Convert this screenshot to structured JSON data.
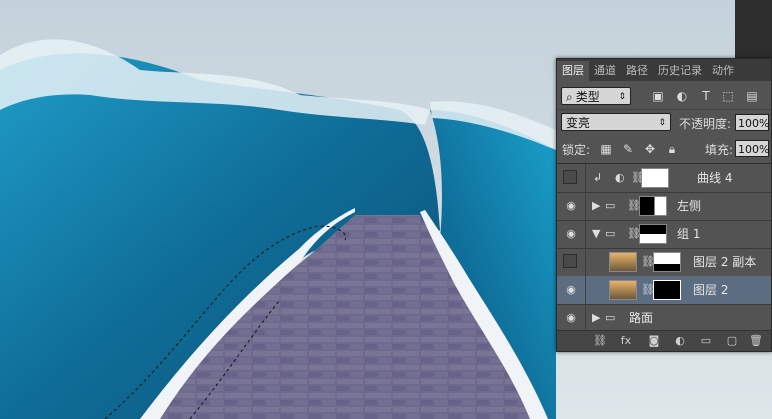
{
  "panel": {
    "tabs": [
      "图层",
      "通道",
      "路径",
      "历史记录",
      "动作"
    ],
    "filter_kind_label": "类型",
    "blend_mode": "变亮",
    "opacity_label": "不透明度:",
    "opacity_value": "100%",
    "lock_label": "锁定:",
    "fill_label": "填充:",
    "fill_value": "100%",
    "layers": [
      {
        "name": "曲线 4",
        "visible": false,
        "kind": "adjustment"
      },
      {
        "name": "左侧",
        "visible": true,
        "kind": "group"
      },
      {
        "name": "组 1",
        "visible": true,
        "kind": "group-open"
      },
      {
        "name": "图层 2 副本",
        "visible": false,
        "kind": "layer"
      },
      {
        "name": "图层 2",
        "visible": true,
        "kind": "layer",
        "selected": true
      },
      {
        "name": "路面",
        "visible": true,
        "kind": "group"
      }
    ]
  },
  "colors": {
    "panel_bg": "#535353",
    "selected_row": "#5c6d82",
    "sea": "#1a7fa8",
    "road": "#6b6789"
  }
}
